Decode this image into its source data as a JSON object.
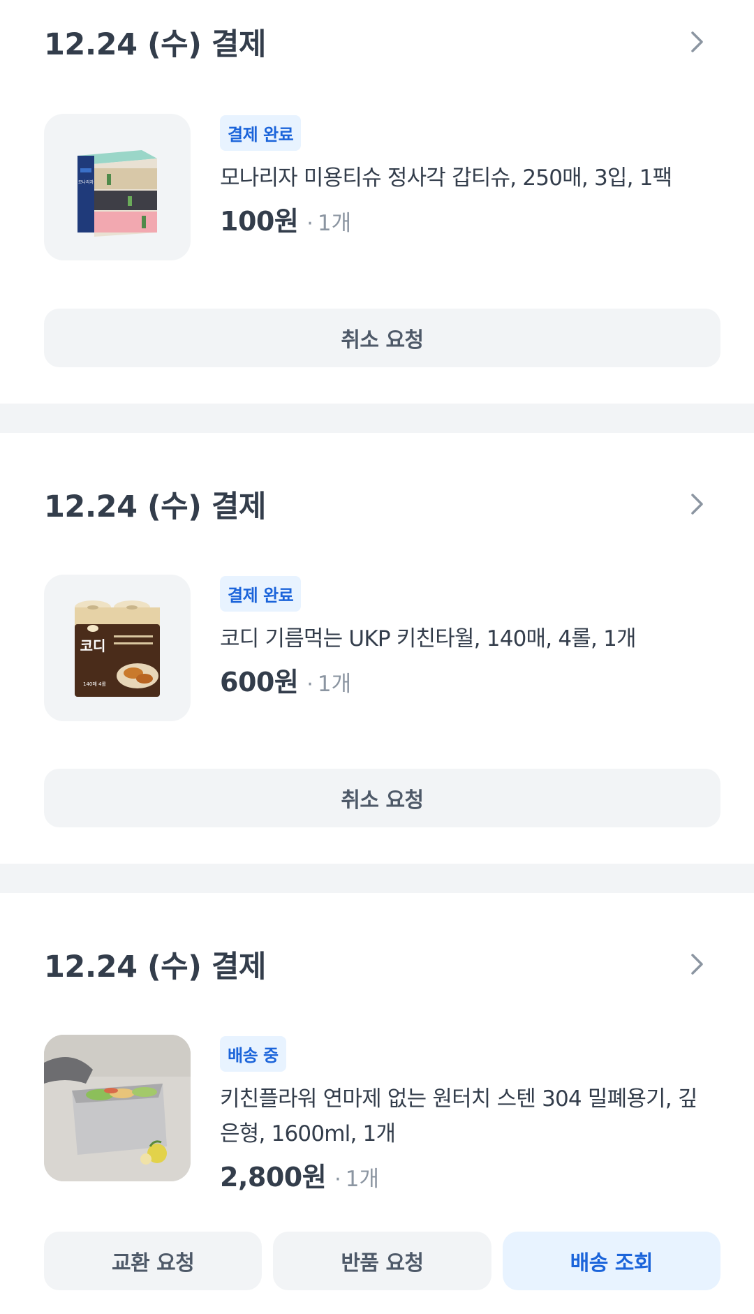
{
  "orders": [
    {
      "date": "12.24 (수) 결제",
      "status": "결제 완료",
      "product_name": "모나리자 미용티슈 정사각 갑티슈, 250매, 3입, 1팩",
      "price": "100원",
      "dot": "·",
      "quantity": "1개",
      "thumbnail_icon": "tissue-box-product-image",
      "thumbnail_text": "모나리자",
      "actions": [
        "취소 요청"
      ]
    },
    {
      "date": "12.24 (수) 결제",
      "status": "결제 완료",
      "product_name": "코디 기름먹는 UKP 키친타월, 140매, 4롤, 1개",
      "price": "600원",
      "dot": "·",
      "quantity": "1개",
      "thumbnail_icon": "kitchen-towel-product-image",
      "thumbnail_text": "코디",
      "thumbnail_subtext": "140매 4롤",
      "actions": [
        "취소 요청"
      ]
    },
    {
      "date": "12.24 (수) 결제",
      "status": "배송 중",
      "product_name": "키친플라워 연마제 없는 원터치 스텐 304 밀폐용기, 깊은형, 1600ml, 1개",
      "price": "2,800원",
      "dot": "·",
      "quantity": "1개",
      "thumbnail_icon": "steel-container-product-image",
      "actions": [
        "교환 요청",
        "반품 요청",
        "배송 조회"
      ]
    }
  ],
  "colors": {
    "badge_bg": "#e8f3ff",
    "badge_text": "#1b64da",
    "button_bg": "#f2f4f6",
    "divider": "#f2f4f6"
  }
}
